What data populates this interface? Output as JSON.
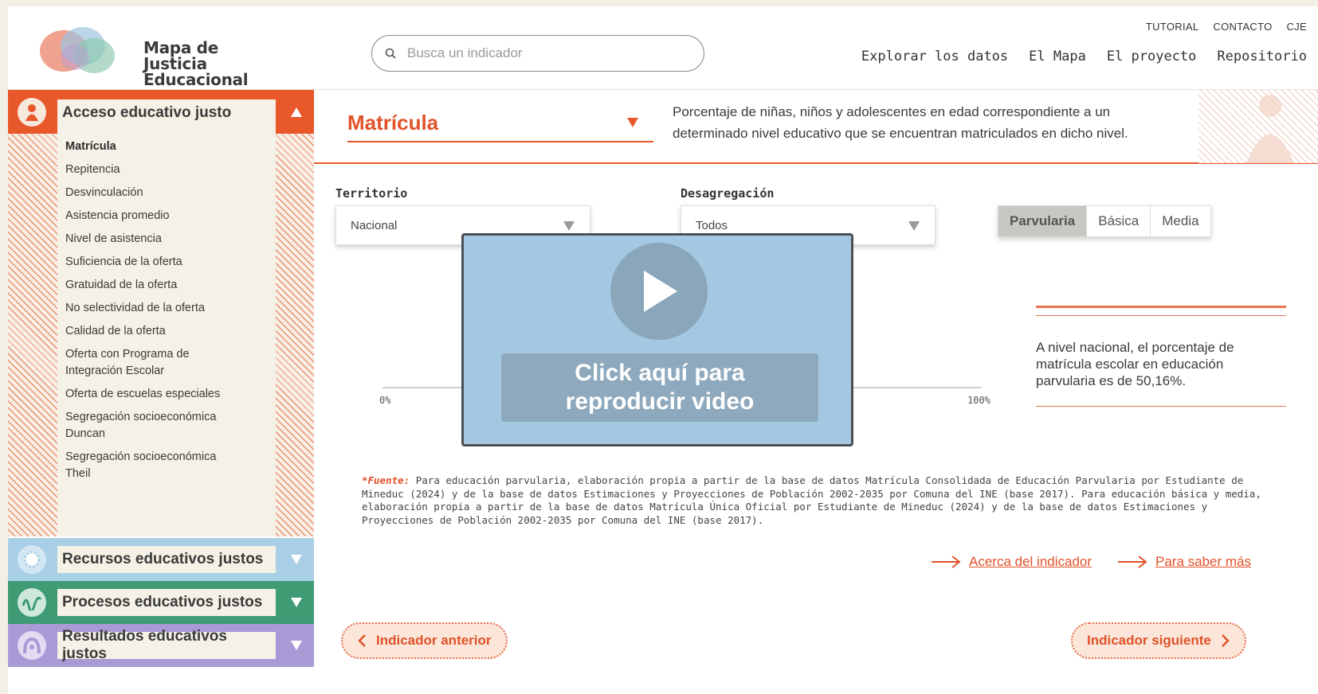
{
  "logo": {
    "line1": "Mapa de",
    "line2": "Justicia",
    "line3": "Educacional"
  },
  "search": {
    "placeholder": "Busca un indicador"
  },
  "top_links": [
    "TUTORIAL",
    "CONTACTO",
    "CJE"
  ],
  "main_nav": [
    "Explorar los datos",
    "El Mapa",
    "El proyecto",
    "Repositorio"
  ],
  "sidebar": {
    "acceso": {
      "label": "Acceso educativo justo",
      "color": "#e8582a",
      "items": [
        "Matrícula",
        "Repitencia",
        "Desvinculación",
        "Asistencia promedio",
        "Nivel de asistencia",
        "Suficiencia de la oferta",
        "Gratuidad de la oferta",
        "No selectividad de la oferta",
        "Calidad de la oferta",
        "Oferta con Programa de Integración Escolar",
        "Oferta de escuelas especiales",
        "Segregación socioeconómica Duncan",
        "Segregación socioeconómica Theil"
      ],
      "active_item": "Matrícula"
    },
    "recursos": {
      "label": "Recursos educativos justos",
      "color": "#a9cfe6"
    },
    "procesos": {
      "label": "Procesos educativos justos",
      "color": "#3f9b74"
    },
    "resultados": {
      "label": "Resultados educativos justos",
      "color": "#a99ad6"
    }
  },
  "indicator": {
    "title": "Matrícula",
    "description": "Porcentaje de niñas, niños y adolescentes en edad correspondiente a un determinado nivel educativo que se encuentran matriculados en dicho nivel."
  },
  "filters": {
    "territorio": {
      "label": "Territorio",
      "value": "Nacional"
    },
    "desagregacion": {
      "label": "Desagregación",
      "value": "Todos"
    }
  },
  "levels": {
    "tabs": [
      "Parvularia",
      "Básica",
      "Media"
    ],
    "active": "Parvularia"
  },
  "axis": {
    "min_label": "0%",
    "max_label": "100%"
  },
  "video": {
    "caption": "Click aquí para\nreproducir video"
  },
  "summary": {
    "text": "A nivel nacional, el porcentaje de matrícula escolar en educación parvularia es de 50,16%."
  },
  "source": {
    "label": "*Fuente:",
    "text": "Para educación parvularia, elaboración propia a partir de la base de datos Matrícula Consolidada de Educación Parvularia por Estudiante de Mineduc (2024) y de la base de datos Estimaciones y Proyecciones de Población 2002-2035 por Comuna del INE (base 2017). Para educación básica y media, elaboración propia a partir de la base de datos Matrícula Única Oficial por Estudiante de Mineduc (2024) y de la base de datos Estimaciones y Proyecciones de Población 2002-2035 por Comuna del INE (base 2017)."
  },
  "links": {
    "acerca": "Acerca del indicador",
    "saber_mas": "Para saber más"
  },
  "pager": {
    "prev": "Indicador anterior",
    "next": "Indicador siguiente"
  },
  "colors": {
    "accent": "#e0522a",
    "cream": "#f4f1e6"
  }
}
